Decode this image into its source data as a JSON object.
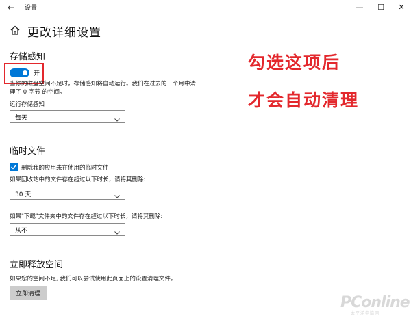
{
  "window": {
    "title": "设置",
    "back_glyph": "←",
    "minimize_glyph": "—",
    "maximize_glyph": "☐",
    "close_glyph": "✕"
  },
  "page": {
    "title": "更改详细设置"
  },
  "storage_sense": {
    "heading": "存储感知",
    "toggle_state": "开",
    "toggle_on": true,
    "description": [
      "当你的磁盘空间不足时，存储感知将自动运行。我们在过去的一个月中清",
      "理了 0 字节 的空间。"
    ],
    "run_label": "运行存储感知",
    "run_value": "每天"
  },
  "temp_files": {
    "heading": "临时文件",
    "checkbox_label": "删除我的应用未在使用的临时文件",
    "checkbox_checked": true,
    "recycle_label": "如果回收站中的文件存在超过以下时长，请将其删除:",
    "recycle_value": "30 天",
    "downloads_label": "如果\"下载\"文件夹中的文件存在超过以下时长，请将其删除:",
    "downloads_value": "从不"
  },
  "free_space": {
    "heading": "立即释放空间",
    "description": "如果您的空间不足, 我们可以尝试使用此页面上的设置清理文件。",
    "button_label": "立即清理"
  },
  "annotations": {
    "line1": "勾选这项后",
    "line2": "才会自动清理",
    "color": "#e3282d"
  },
  "watermark": {
    "text": "PConline",
    "sub": "太平洋电脑网"
  },
  "colors": {
    "accent": "#0078d7",
    "highlight": "#e3282d"
  }
}
